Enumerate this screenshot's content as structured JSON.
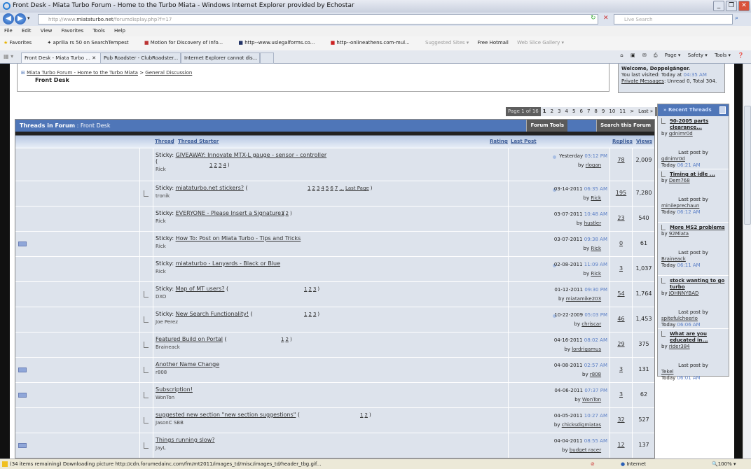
{
  "browser": {
    "title": "Front Desk - Miata Turbo Forum - Home to the Turbo Miata - Windows Internet Explorer provided by Echostar",
    "url_prefix": "http://www.",
    "url_domain": "miataturbo.net",
    "url_path": "/forumdisplay.php?f=17",
    "search_placeholder": "Live Search",
    "menu": [
      "File",
      "Edit",
      "View",
      "Favorites",
      "Tools",
      "Help"
    ],
    "favorites": [
      "Favorites",
      "aprilia rs 50 on SearchTempest",
      "Motion for Discovery of Info...",
      "http--www.uslegalforms.co...",
      "http--onlineathens.com-mul...",
      "Suggested Sites ▾",
      "Free Hotmail",
      "Web Slice Gallery ▾"
    ],
    "tabs": [
      "Front Desk - Miata Turbo ...",
      "Pub Roadster - ClubRoadster...",
      "Internet Explorer cannot dis..."
    ],
    "commands": [
      "Page ▾",
      "Safety ▾",
      "Tools ▾"
    ],
    "status_text": "(34 items remaining) Downloading picture http://cdn.forumedainc.com/fm/mt2011/images_td/misc/images_td/header_tbg.gif...",
    "zone": "Internet",
    "zoom": "100%"
  },
  "breadcrumb": {
    "home": "Miata Turbo Forum - Home to the Turbo Miata",
    "sep": ">",
    "parent": "General Discussion",
    "current": "Front Desk"
  },
  "welcome": {
    "greeting": "Welcome, Doppelgänger.",
    "last_visited_label": "You last visited: Today at",
    "last_visited_time": "04:35 AM",
    "pm_link": "Private Messages",
    "pm_text": ": Unread 0, Total 304."
  },
  "pager": {
    "label": "Page 1 of 16",
    "pages": [
      "1",
      "2",
      "3",
      "4",
      "5",
      "6",
      "7",
      "8",
      "9",
      "10",
      "11"
    ],
    "next": ">",
    "last": "Last »"
  },
  "forum": {
    "header": "Threads in Forum",
    "name": ": Front Desk",
    "tools": "Forum Tools",
    "search": "Search this Forum",
    "columns": {
      "thread": "Thread",
      "sep": " / ",
      "starter": "Thread Starter",
      "rating": "Rating",
      "last_post": "Last Post",
      "replies": "Replies",
      "views": "Views"
    },
    "threads": [
      {
        "prefix": "Sticky: ",
        "title": "GIVEAWAY: Innovate MTX-L gauge - sensor - controller",
        "pages": [
          "1",
          "2",
          "3",
          "4"
        ],
        "starter": "Rick",
        "date": "Yesterday",
        "time": "03:12 PM",
        "by": "rlogan",
        "replies": "78",
        "views": "2,009",
        "icon": "none",
        "wrap": true
      },
      {
        "prefix": "Sticky: ",
        "title": "miataturbo.net stickers?",
        "pages": [
          "1",
          "2",
          "3",
          "4",
          "5",
          "6",
          "7",
          "...",
          "Last Page"
        ],
        "starter": "tronik",
        "date": "03-14-2011",
        "time": "06:35 AM",
        "by": "Rick",
        "replies": "195",
        "views": "7,280",
        "icon": "doc"
      },
      {
        "prefix": "Sticky: ",
        "title": "EVERYONE - Please Insert a Signature",
        "pages": [
          "1",
          "2"
        ],
        "starter": "Rick",
        "date": "03-07-2011",
        "time": "10:48 AM",
        "by": "hustler",
        "replies": "23",
        "views": "540",
        "icon": "none"
      },
      {
        "prefix": "Sticky: ",
        "title": "How To: Post on Miata Turbo - Tips and Tricks",
        "pages": [],
        "starter": "Rick",
        "date": "03-07-2011",
        "time": "09:38 AM",
        "by": "Rick",
        "replies": "0",
        "views": "61",
        "icon": "none",
        "env": true
      },
      {
        "prefix": "Sticky: ",
        "title": "miataturbo - Lanyards - Black or Blue",
        "pages": [],
        "starter": "Rick",
        "date": "02-08-2011",
        "time": "11:09 AM",
        "by": "Rick",
        "replies": "3",
        "views": "1,037",
        "icon": "none"
      },
      {
        "prefix": "Sticky: ",
        "title": "Map of MT users?",
        "pages": [
          "1",
          "2",
          "3"
        ],
        "starter": "DXO",
        "date": "01-12-2011",
        "time": "09:30 PM",
        "by": "miatamike203",
        "replies": "54",
        "views": "1,764",
        "icon": "doc"
      },
      {
        "prefix": "Sticky: ",
        "title": "New Search Functionality!",
        "pages": [
          "1",
          "2",
          "3"
        ],
        "starter": "Joe Perez",
        "date": "10-22-2009",
        "time": "05:03 PM",
        "by": "chriscar",
        "replies": "46",
        "views": "1,453",
        "icon": "doc"
      },
      {
        "prefix": "",
        "title": "Featured Build on Portal",
        "pages": [
          "1",
          "2"
        ],
        "starter": "Braineack",
        "date": "04-16-2011",
        "time": "08:02 AM",
        "by": "lordrigamus",
        "replies": "29",
        "views": "375",
        "icon": "doc"
      },
      {
        "prefix": "",
        "title": "Another Name Change",
        "pages": [],
        "starter": "r808",
        "date": "04-08-2011",
        "time": "02:57 AM",
        "by": "r808",
        "replies": "3",
        "views": "131",
        "icon": "doc",
        "env": true
      },
      {
        "prefix": "",
        "title": "Subscription!",
        "pages": [],
        "starter": "WonTon",
        "date": "04-06-2011",
        "time": "07:37 PM",
        "by": "WonTon",
        "replies": "3",
        "views": "62",
        "icon": "doc",
        "env": true
      },
      {
        "prefix": "",
        "title": "suggested new section \"new section suggestions\"",
        "pages": [
          "1",
          "2"
        ],
        "starter": "JasonC SBB",
        "date": "04-05-2011",
        "time": "10:27 AM",
        "by": "chicksdigmiatas",
        "replies": "32",
        "views": "527",
        "icon": "doc"
      },
      {
        "prefix": "",
        "title": "Things running slow?",
        "pages": [],
        "starter": "JayL",
        "date": "04-04-2011",
        "time": "08:55 AM",
        "by": "budget racer",
        "replies": "12",
        "views": "137",
        "icon": "doc",
        "env": true
      }
    ]
  },
  "recent": {
    "title": "» Recent Threads",
    "by_label": "by",
    "last_label": "Last post by",
    "today": "Today",
    "items": [
      {
        "title": "90-2005 parts clearance...",
        "by": "gdnimr0d",
        "last_by": "gdnimr0d",
        "time": "06:21 AM"
      },
      {
        "title": "Timing at idle ...",
        "by": "Dem768",
        "last_by": "minileprechaun",
        "time": "06:12 AM"
      },
      {
        "title": "More MS2 problems",
        "by": "92Miata",
        "last_by": "Braineack",
        "time": "06:11 AM"
      },
      {
        "title": "stock wanting to go turbo",
        "by": "JOHNNYBAD",
        "last_by": "spitefulcheerio",
        "time": "06:06 AM"
      },
      {
        "title": "What are you educated in...",
        "by": "rider384",
        "last_by": "Tekel",
        "time": "06:01 AM"
      }
    ]
  },
  "colors": {
    "header_blue": "#4f76b8",
    "row_bg": "#dde3ec",
    "time_blue": "#5b7fc6"
  }
}
